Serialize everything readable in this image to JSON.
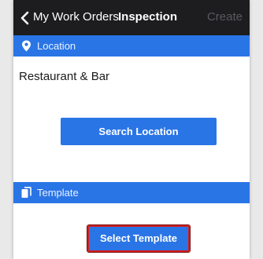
{
  "header": {
    "back_label": "My Work Orders",
    "title": "Inspection",
    "create_label": "Create"
  },
  "location_section": {
    "icon": "map-pin-icon",
    "label": "Location",
    "value": "Restaurant & Bar",
    "button_label": "Search Location"
  },
  "template_section": {
    "icon": "documents-icon",
    "label": "Template",
    "button_label": "Select Template"
  },
  "colors": {
    "topbar": "#1d1d1f",
    "accent_blue": "#2a75e6",
    "highlight_red": "#d61c1c",
    "disabled_text": "#5a5a5f"
  }
}
